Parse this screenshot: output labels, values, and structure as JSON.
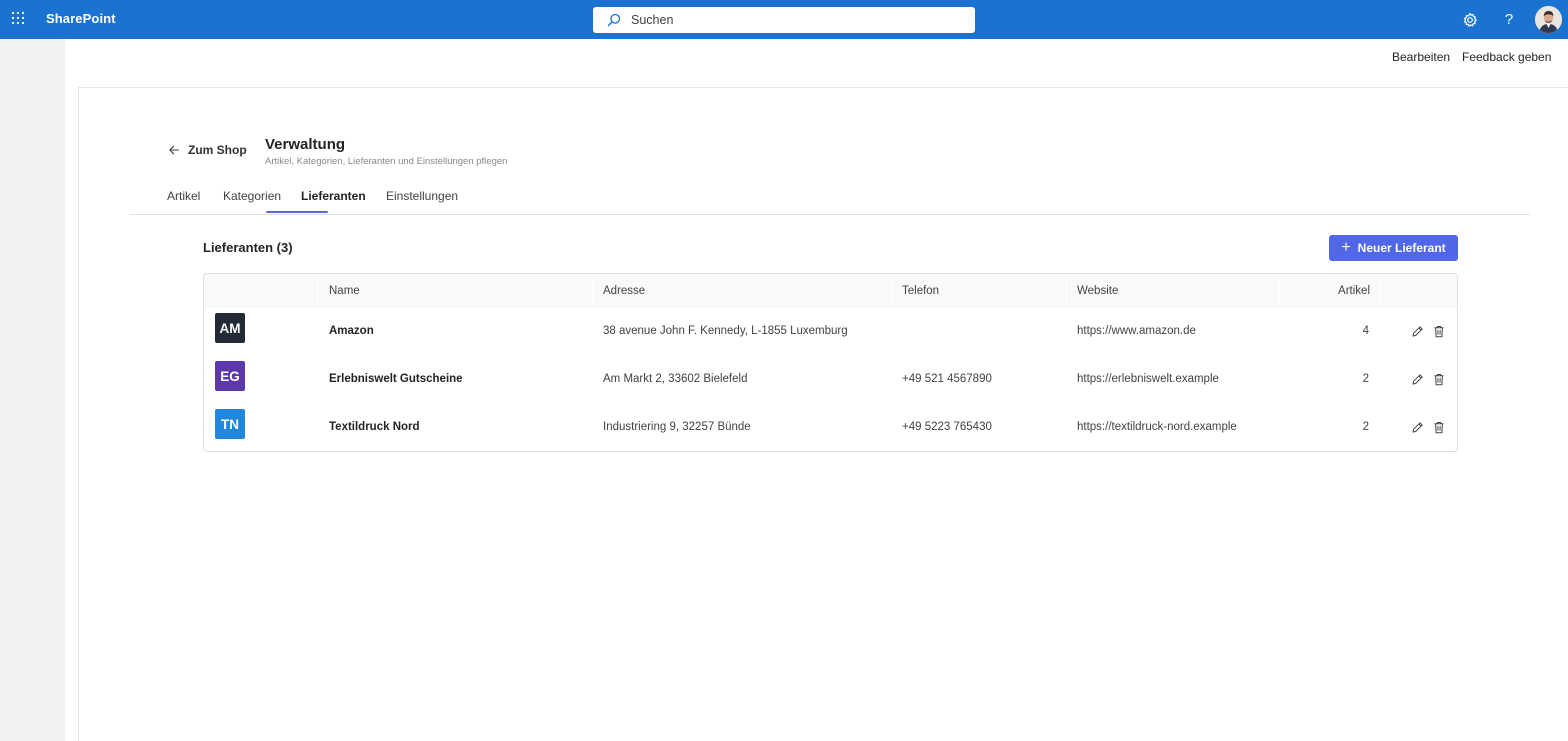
{
  "suitebar": {
    "brand": "SharePoint",
    "search_placeholder": "Suchen",
    "icons": [
      "waffle-icon",
      "gear-icon",
      "help-icon",
      "avatar"
    ],
    "help_glyph": "?"
  },
  "commandbar": {
    "edit_label": "Bearbeiten",
    "feedback_label": "Feedback geben"
  },
  "header": {
    "back_label": "Zum Shop",
    "title": "Verwaltung",
    "subtitle": "Artikel, Kategorien, Lieferanten und Einstellungen pflegen"
  },
  "tabs": [
    {
      "label": "Artikel"
    },
    {
      "label": "Kategorien"
    },
    {
      "label": "Lieferanten",
      "active": true
    },
    {
      "label": "Einstellungen"
    }
  ],
  "section": {
    "title": "Lieferanten (3)",
    "new_button_label": "Neuer Lieferant",
    "new_button_glyph": "+"
  },
  "table": {
    "columns": [
      "Name",
      "Adresse",
      "Telefon",
      "Website",
      "Artikel"
    ],
    "rows": [
      {
        "initials": "AM",
        "color": "#222a36",
        "name": "Amazon",
        "address": "38 avenue John F. Kennedy, L-1855 Luxemburg",
        "phone": "",
        "website": "https://www.amazon.de",
        "articles": "4"
      },
      {
        "initials": "EG",
        "color": "#5c38a8",
        "name": "Erlebniswelt Gutscheine",
        "address": "Am Markt 2, 33602 Bielefeld",
        "phone": "+49 521 4567890",
        "website": "https://erlebniswelt.example",
        "articles": "2"
      },
      {
        "initials": "TN",
        "color": "#1f87dd",
        "name": "Textildruck Nord",
        "address": "Industriering 9, 32257 Bünde",
        "phone": "+49 5223 765430",
        "website": "https://textildruck-nord.example",
        "articles": "2"
      }
    ]
  },
  "colors": {
    "suitebar": "#1b73d1",
    "accent": "#4f67e8",
    "tab_underline": "#5b6bd6"
  }
}
